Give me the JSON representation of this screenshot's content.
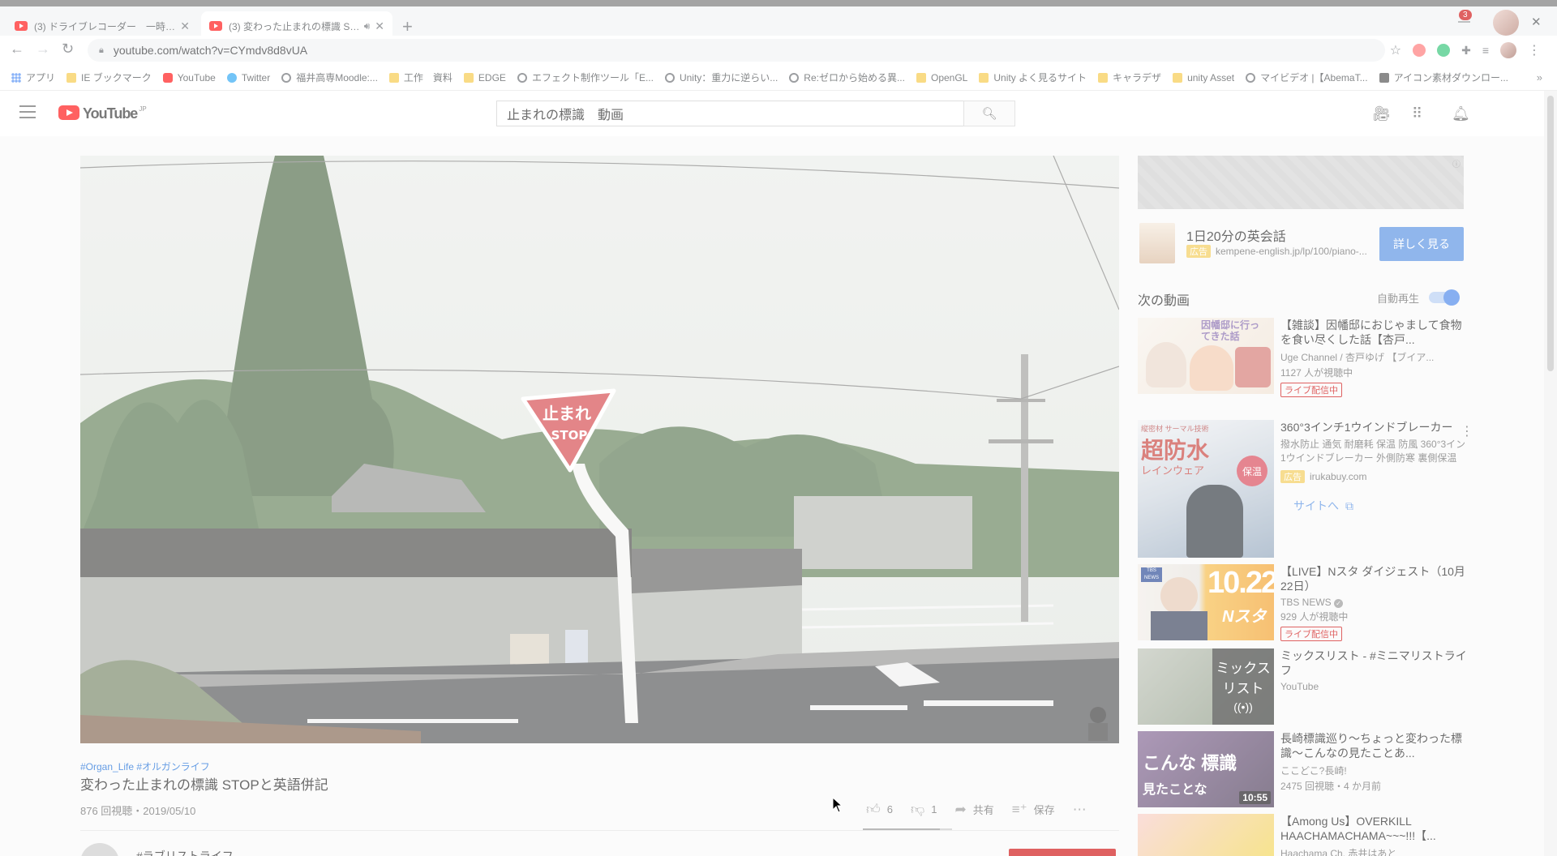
{
  "browser": {
    "tabs": [
      {
        "title": "(3) ドライブレコーダー　一時停止標識",
        "active": false
      },
      {
        "title": "(3) 変わった止まれの標識 STOP",
        "active": true
      }
    ],
    "url": "youtube.com/watch?v=CYmdv8d8vUA",
    "bookmarks": [
      {
        "label": "アプリ",
        "icon": "apps-icon"
      },
      {
        "label": "IE ブックマーク",
        "icon": "folder-icon"
      },
      {
        "label": "YouTube",
        "icon": "youtube-icon"
      },
      {
        "label": "Twitter",
        "icon": "twitter-icon"
      },
      {
        "label": "福井高専Moodle:...",
        "icon": "globe-icon"
      },
      {
        "label": "工作　資料",
        "icon": "folder-icon"
      },
      {
        "label": "EDGE",
        "icon": "folder-icon"
      },
      {
        "label": "エフェクト制作ツール「E...",
        "icon": "globe-icon"
      },
      {
        "label": "Unity：重力に逆らい...",
        "icon": "globe-icon"
      },
      {
        "label": "Re:ゼロから始める異...",
        "icon": "globe-icon"
      },
      {
        "label": "OpenGL",
        "icon": "folder-icon"
      },
      {
        "label": "Unity よく見るサイト",
        "icon": "folder-icon"
      },
      {
        "label": "キャラデザ",
        "icon": "folder-icon"
      },
      {
        "label": "unity Asset",
        "icon": "folder-icon"
      },
      {
        "label": "マイビデオ |【AbemaT...",
        "icon": "globe-icon"
      },
      {
        "label": "アイコン素材ダウンロー...",
        "icon": "picture-icon"
      }
    ]
  },
  "youtube": {
    "logo_text": "YouTube",
    "logo_region": "JP",
    "search_value": "止まれの標識　動画",
    "notification_count": "3"
  },
  "video": {
    "sign_line1": "止まれ",
    "sign_line2": "STOP",
    "tags": "#Organ_Life #オルガンライフ",
    "title": "変わった止まれの標識 STOPと英語併記",
    "meta": "876 回視聴・2019/05/10",
    "likes": "6",
    "dislikes": "1",
    "like_ratio": 0.86,
    "share_label": "共有",
    "save_label": "保存",
    "owner_name": "#ラブリストライフ"
  },
  "ad": {
    "title": "1日20分の英会話",
    "tag": "広告",
    "url": "kempene-english.jp/lp/100/piano-...",
    "cta": "詳しく見る"
  },
  "sidebar": {
    "next_label": "次の動画",
    "autoplay_label": "自動再生",
    "autoplay_on": true,
    "items": [
      {
        "title": "【雑談】因幡邸におじゃまして食物を食い尽くした話【杏戸...",
        "channel": "Uge Channel / 杏戸ゆげ 【ブイア...",
        "views": "1127 人が視聴中",
        "badge": "ライブ配信中",
        "thumb_text": "因幡邸に行ってきた話",
        "colors": [
          "#f4efe8",
          "#e8a5b8"
        ]
      },
      {
        "title": "360°3インチ1ウインドブレーカー",
        "channel": "撥水防止 通気 耐磨耗 保温 防風 360°3イン1ウインドブレーカー 外側防寒 裏側保温",
        "views": "irukabuy.com",
        "ad_tag": "広告",
        "site_label": "サイトへ",
        "thumb_text": "超防水",
        "thumb_sub": "レインウェア",
        "thumb_badge": "保温",
        "thumb_top": "縦密材 サーマル技術",
        "colors": [
          "#e9ecef",
          "#1d5aa8"
        ]
      },
      {
        "title": "【LIVE】Nスタ ダイジェスト（10月22日）",
        "channel": "TBS NEWS",
        "views": "929 人が視聴中",
        "badge": "ライブ配信中",
        "thumb_text": "10.22",
        "thumb_sub": "Nスタ",
        "thumb_logo": "TBS NEWS",
        "colors": [
          "#f5a623",
          "#ffffff"
        ]
      },
      {
        "title": "ミックスリスト - #ミニマリストライフ",
        "channel": "YouTube",
        "views": "",
        "thumb_text": "ミックス",
        "thumb_sub": "リスト",
        "colors": [
          "#4a4a4a",
          "#ffffff"
        ]
      },
      {
        "title": "長崎標識巡り～ちょっと変わった標識～こんなの見たことあ...",
        "channel": "ここどこ?長崎!",
        "views": "2475 回視聴・4 か月前",
        "duration": "10:55",
        "thumb_text": "こんな 標識",
        "thumb_sub": "見たことな",
        "colors": [
          "#6b4b7a",
          "#f05a8c"
        ]
      },
      {
        "title": "【Among Us】OVERKILL HAACHAMACHAMA~~~!!!【...",
        "channel": "Haachama Ch. 赤井はあと",
        "views": "",
        "thumb_text": "",
        "colors": [
          "#f5b9b9",
          "#f2d34a"
        ]
      }
    ]
  }
}
